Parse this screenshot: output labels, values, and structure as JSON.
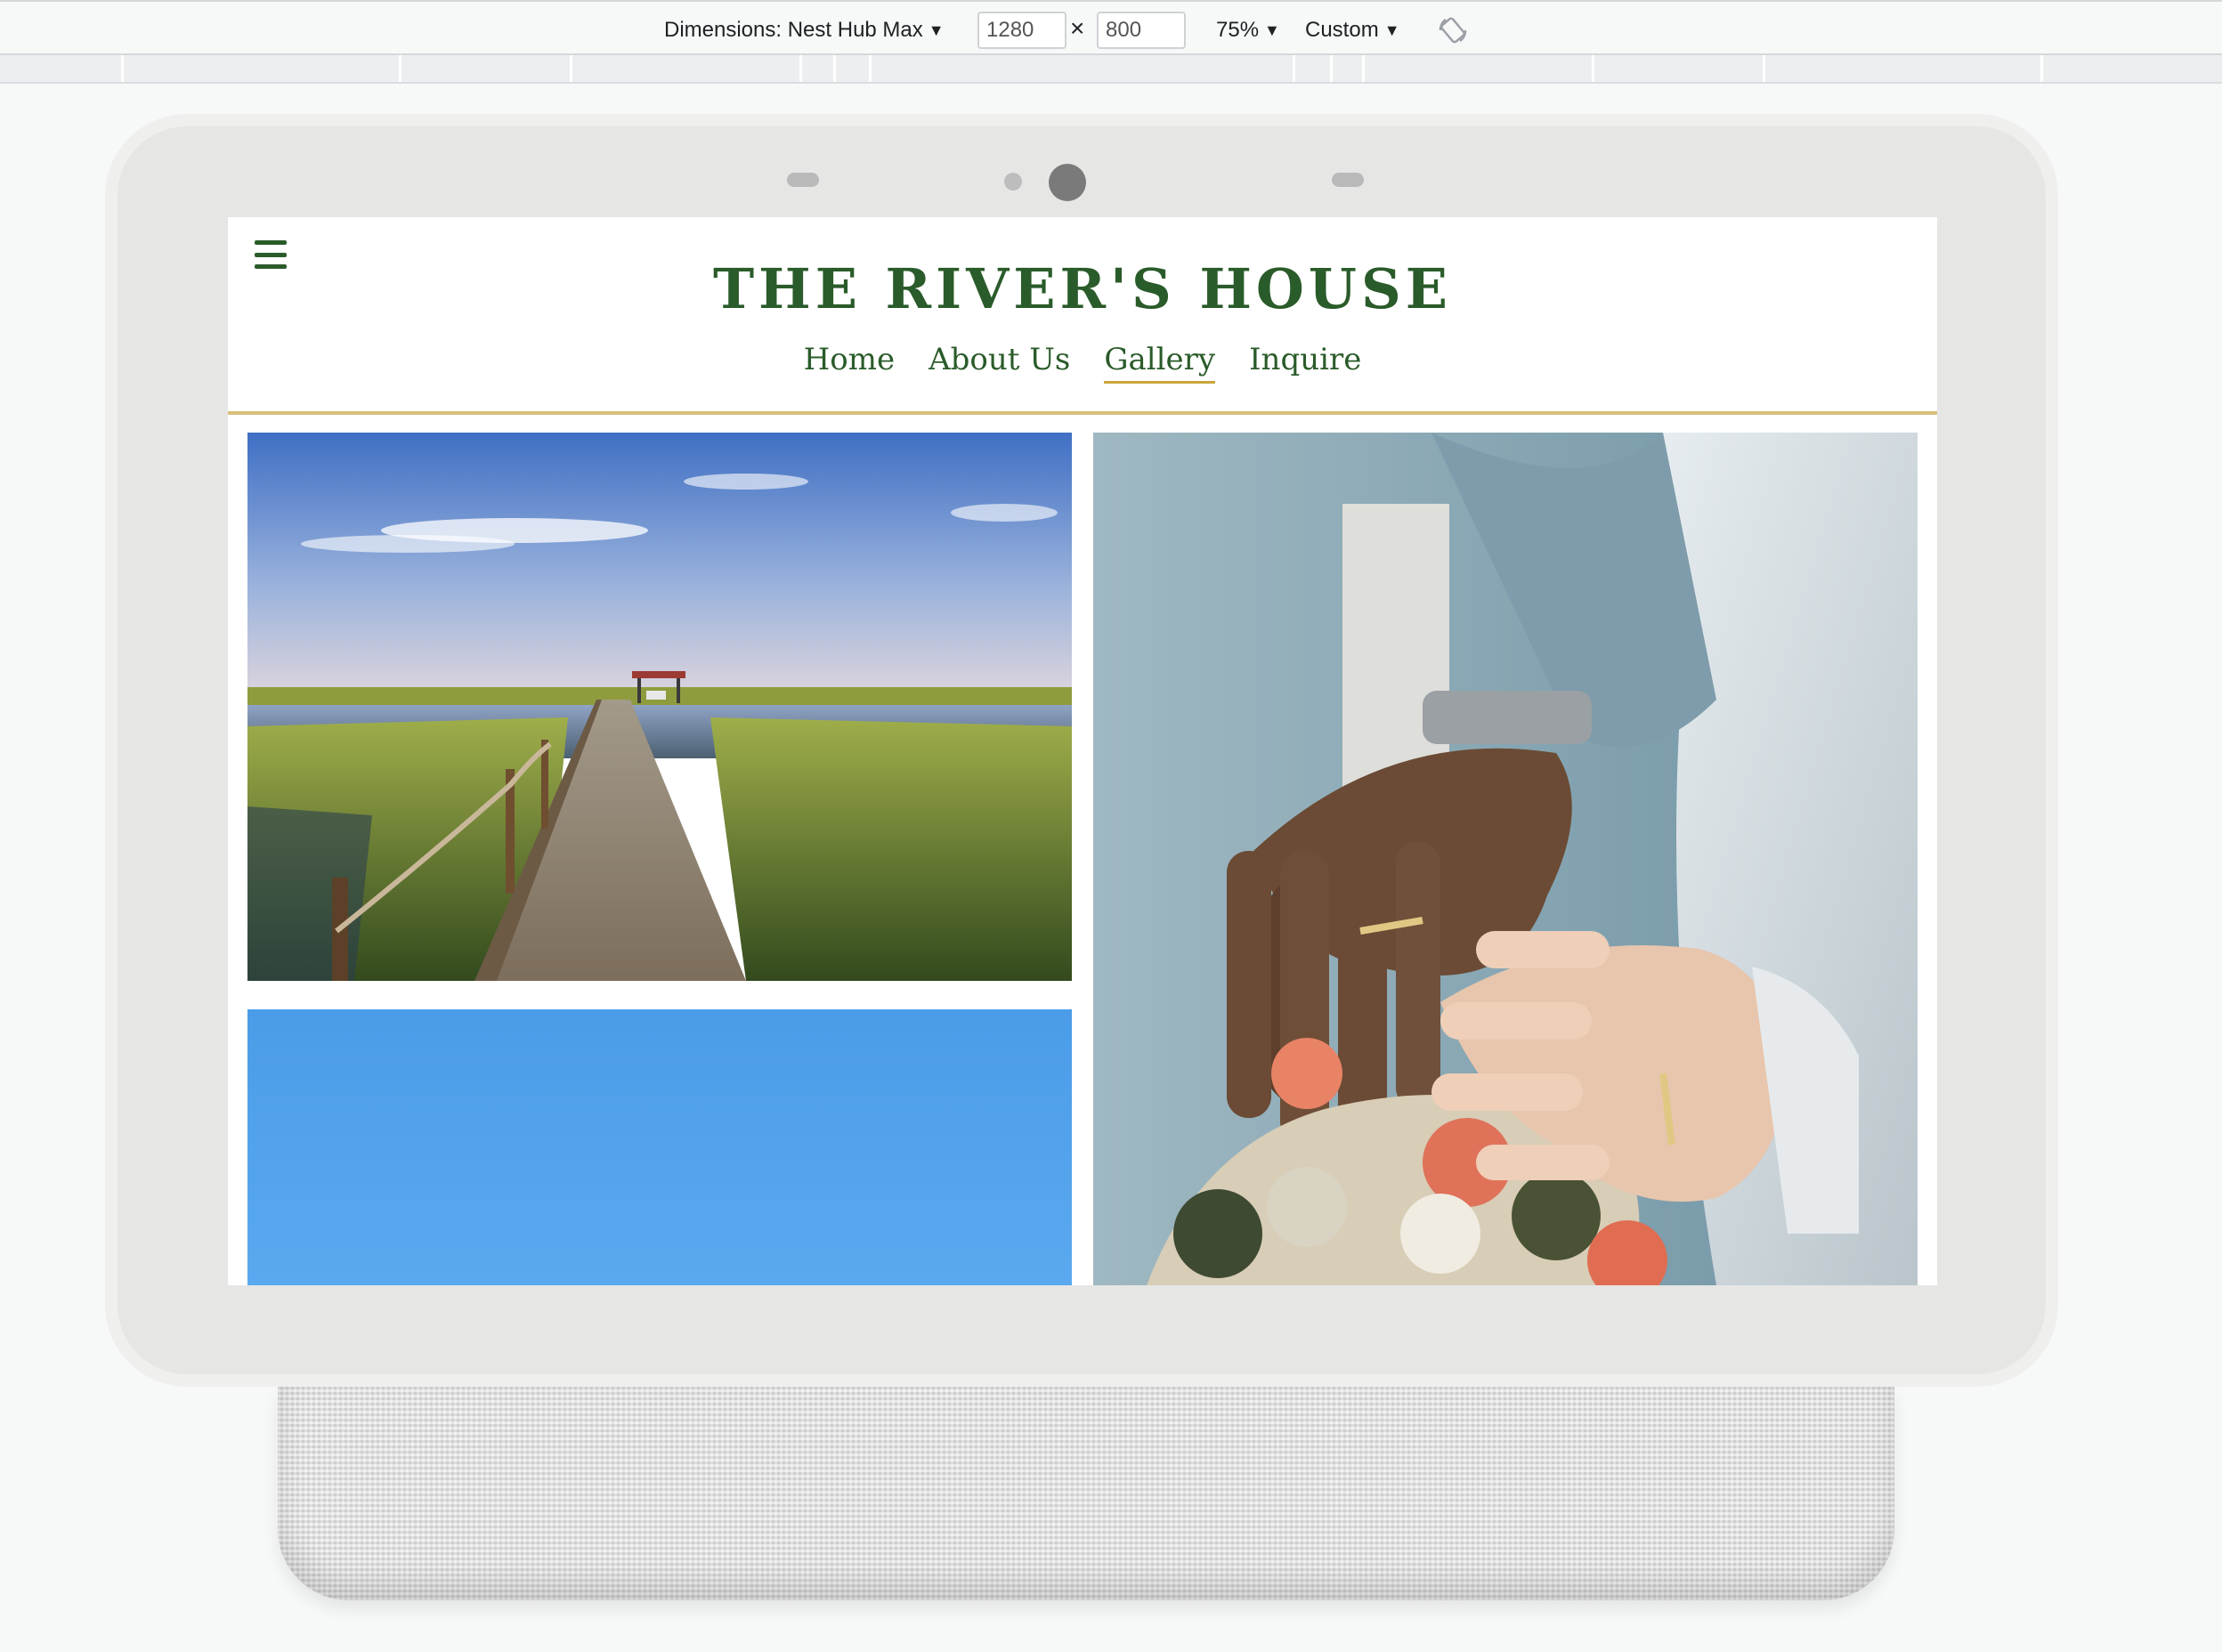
{
  "devtools": {
    "dimensions_label": "Dimensions: Nest Hub Max",
    "width_value": "1280",
    "height_value": "800",
    "times": "×",
    "zoom": "75%",
    "throttle": "Custom",
    "rotate_icon": "rotate-icon"
  },
  "site": {
    "title": "THE RIVER'S HOUSE",
    "nav": [
      "Home",
      "About Us",
      "Gallery",
      "Inquire"
    ],
    "active_nav": "Gallery",
    "menu_icon": "hamburger-menu-icon"
  },
  "gallery": {
    "photos": [
      "marsh-boardwalk-photo",
      "wedding-hands-bouquet-photo",
      "blue-sky-photo"
    ]
  },
  "colors": {
    "brand_green": "#2a5b2a",
    "accent_gold": "#c9a53b"
  }
}
